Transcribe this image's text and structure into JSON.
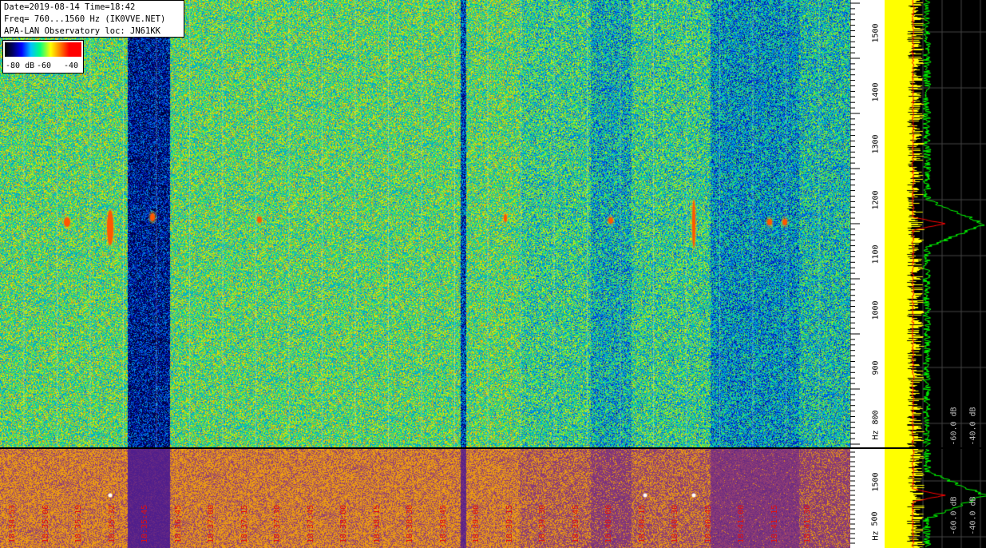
{
  "header": {
    "line1": "Date=2019-08-14 Time=18:42",
    "line2": "Freq= 760...1560 Hz (IK0VVE.NET)",
    "line3": "APA-LAN Observatory loc: JN61KK"
  },
  "scale": {
    "labels": [
      "-80 dB",
      "-60",
      "-40"
    ]
  },
  "freq_axis": {
    "unit": "Hz",
    "ticks": [
      "1500",
      "1400",
      "1300",
      "1200",
      "1100",
      "1000",
      "900",
      "800"
    ]
  },
  "freq_axis_bottom": {
    "unit": "Hz",
    "ticks": [
      "1500",
      "500"
    ]
  },
  "spectrum": {
    "db_labels": [
      "-60.0 dB",
      "-40.0 dB"
    ]
  },
  "timestamps": [
    "18:34:53",
    "18:35:06",
    "18:35:19",
    "18:35:32",
    "18:35:45",
    "18:36:45",
    "18:37:00",
    "18:37:15",
    "18:37:30",
    "18:37:45",
    "18:38:00",
    "18:38:15",
    "18:38:30",
    "18:38:45",
    "18:39:00",
    "18:39:15",
    "18:39:30",
    "18:39:45",
    "18:40:00",
    "18:40:15",
    "18:40:30",
    "18:40:45",
    "18:41:00",
    "18:41:15",
    "18:41:30"
  ],
  "colors": {
    "background": "#000000",
    "timestamp": "#e01010",
    "spectrum_fill": "#ffff00",
    "spectrum_line": "#00ff00",
    "peak_line": "#ff0000"
  }
}
